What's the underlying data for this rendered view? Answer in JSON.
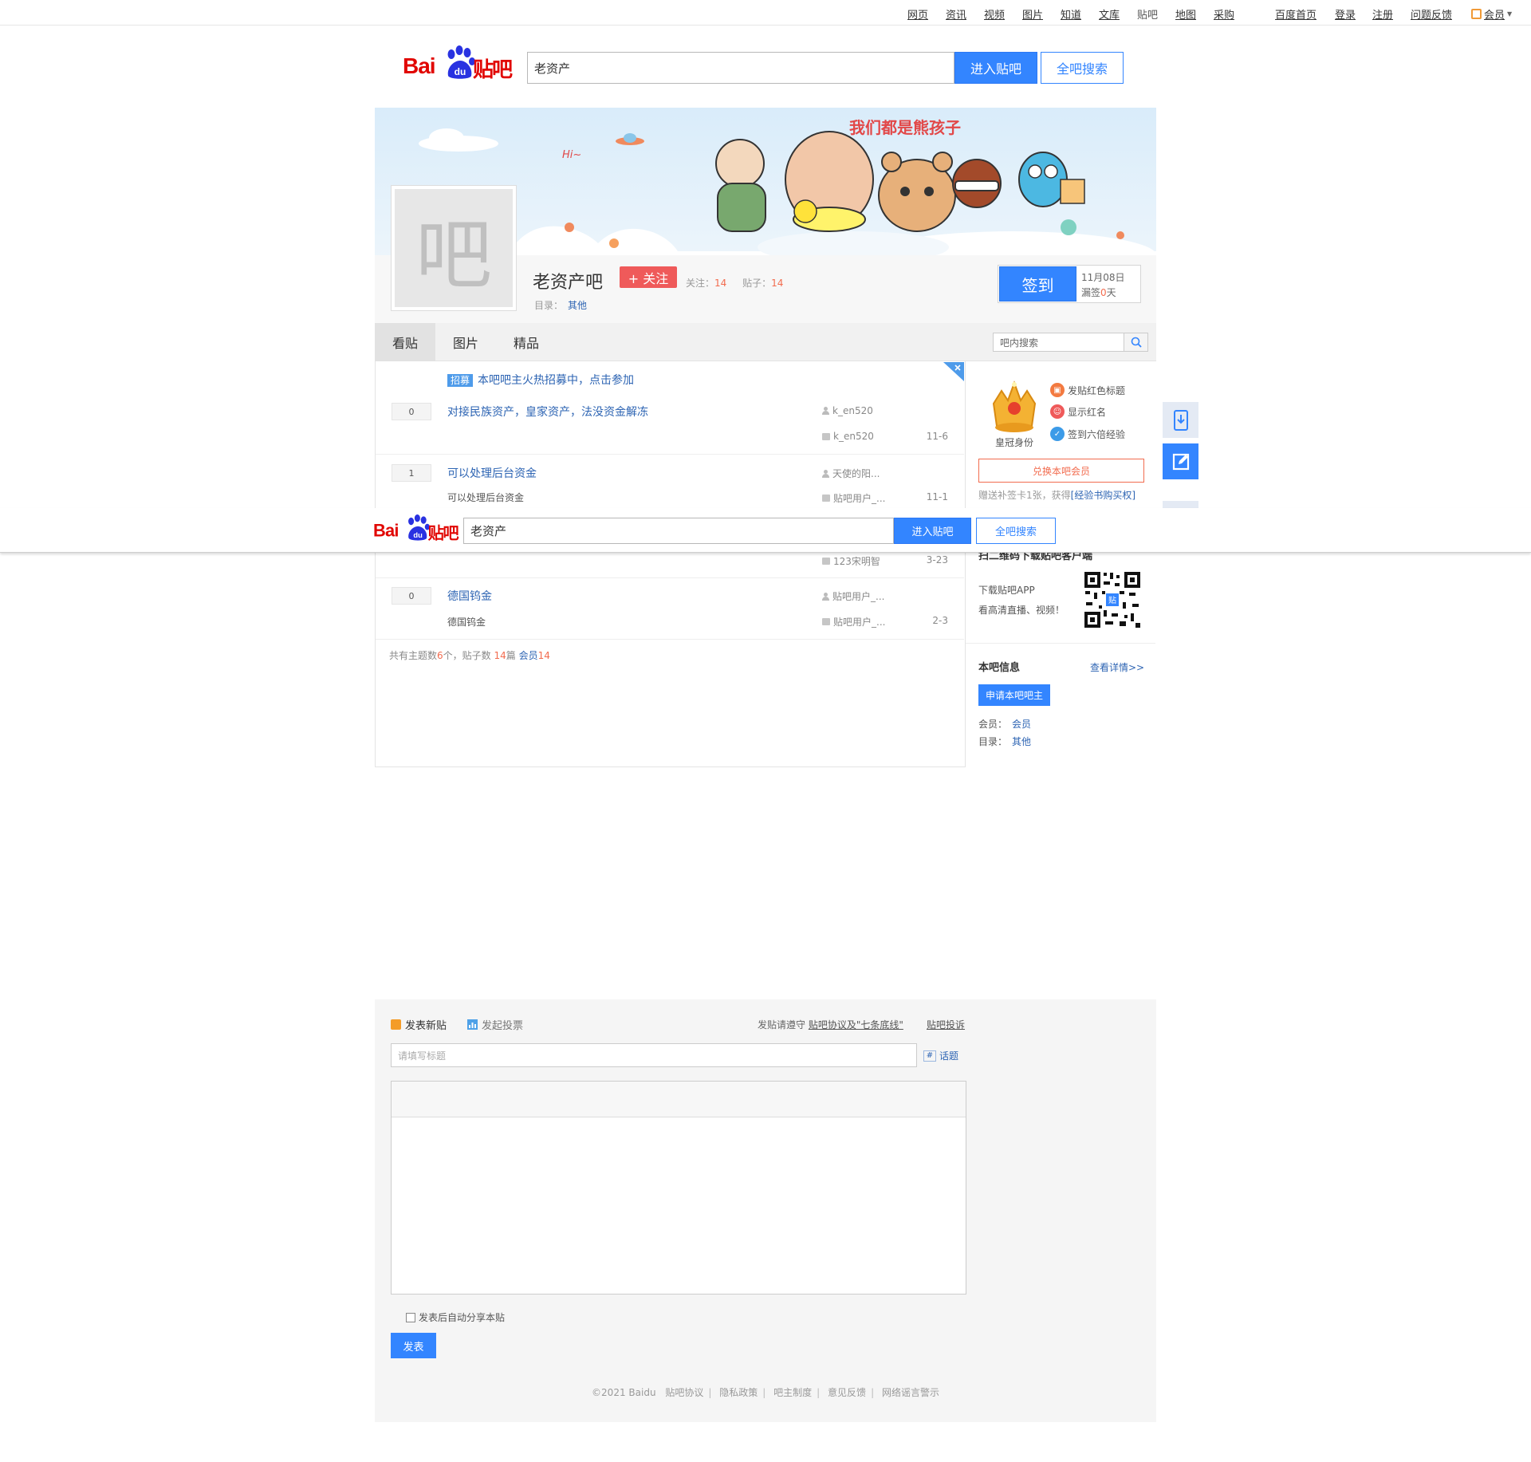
{
  "topnav": {
    "links": [
      "网页",
      "资讯",
      "视频",
      "图片",
      "知道",
      "文库",
      "贴吧",
      "地图",
      "采购"
    ],
    "right_links": [
      "百度首页",
      "登录",
      "注册",
      "问题反馈"
    ],
    "member": "会员"
  },
  "logo": {
    "bai": "Bai",
    "du": "du",
    "tieba": "贴吧"
  },
  "search": {
    "value": "老资产",
    "enter_label": "进入贴吧",
    "all_label": "全吧搜索"
  },
  "banner": {
    "slogan": "我们都是熊孩子",
    "hi": "Hi~"
  },
  "forum": {
    "avatar_char": "吧",
    "name": "老资产吧",
    "follow_label": "+ 关注",
    "followers_label": "关注：",
    "followers": "14",
    "posts_label": "贴子：",
    "posts": "14",
    "dir_label": "目录：",
    "dir_value": "其他"
  },
  "signin": {
    "label": "签到",
    "date": "11月08日",
    "streak_prefix": "漏签",
    "streak_value": "0",
    "streak_suffix": "天"
  },
  "tabs": [
    "看贴",
    "图片",
    "精品"
  ],
  "inner_search": {
    "placeholder": "吧内搜索"
  },
  "recruit": {
    "tag": "招募",
    "text": "本吧吧主火热招募中，点击参加"
  },
  "threads": [
    {
      "replies": "0",
      "title": "对接民族资产，皇家资产，法没资金解冻",
      "abstract": "",
      "author": "k_en520",
      "last": "k_en520",
      "date": "11-6"
    },
    {
      "replies": "1",
      "title": "可以处理后台资金",
      "abstract": "可以处理后台资金",
      "author": "天使的阳...",
      "last": "贴吧用户_...",
      "date": "11-1"
    },
    {
      "replies": "",
      "title": "",
      "abstract": "",
      "author": "",
      "last": "123宋明智",
      "date": "3-23"
    },
    {
      "replies": "0",
      "title": "德国钨金",
      "abstract": "德国钨金",
      "author": "贴吧用户_...",
      "last": "贴吧用户_...",
      "date": "2-3"
    }
  ],
  "summary": {
    "p1": "共有主题数",
    "topics": "6",
    "p2": "个，贴子数 ",
    "posts": "14",
    "p3": "篇 ",
    "members_label": "会员",
    "members": "14"
  },
  "aside": {
    "perks": [
      "发贴红色标题",
      "显示红名",
      "签到六倍经验"
    ],
    "perk_icons": [
      "red-title-icon",
      "red-name-icon",
      "sign-exp-icon"
    ],
    "crown_label": "皇冠身份",
    "member_btn": "兑换本吧会员",
    "note_prefix": "赠送补签卡1张，获得",
    "note_link": "[经验书购买权]",
    "app_title": "扫二维码下载贴吧客户端",
    "app_line1": "下载贴吧APP",
    "app_line2": "看高清直播、视频！",
    "qr_badge": "贴",
    "info_title": "本吧信息",
    "info_more": "查看详情>>",
    "apply_btn": "申请本吧吧主",
    "members_label": "会员：",
    "members_value": "会员",
    "dir_label": "目录：",
    "dir_value": "其他"
  },
  "editor": {
    "tab_post": "发表新贴",
    "tab_vote": "发起投票",
    "rules_prefix": "发贴请遵守 ",
    "rules_link": "贴吧协议及\"七条底线\"",
    "complaint": "贴吧投诉",
    "title_placeholder": "请填写标题",
    "topic": "话题",
    "share_label": "发表后自动分享本贴",
    "publish": "发表"
  },
  "footer": {
    "copyright": "©2021 Baidu",
    "links": [
      "贴吧协议",
      "隐私政策",
      "吧主制度",
      "意见反馈",
      "网络谣言警示"
    ]
  },
  "colors": {
    "accent": "#3385ff",
    "brand_red": "#e10602",
    "highlight": "#f26c4f",
    "link": "#2d64b3"
  }
}
